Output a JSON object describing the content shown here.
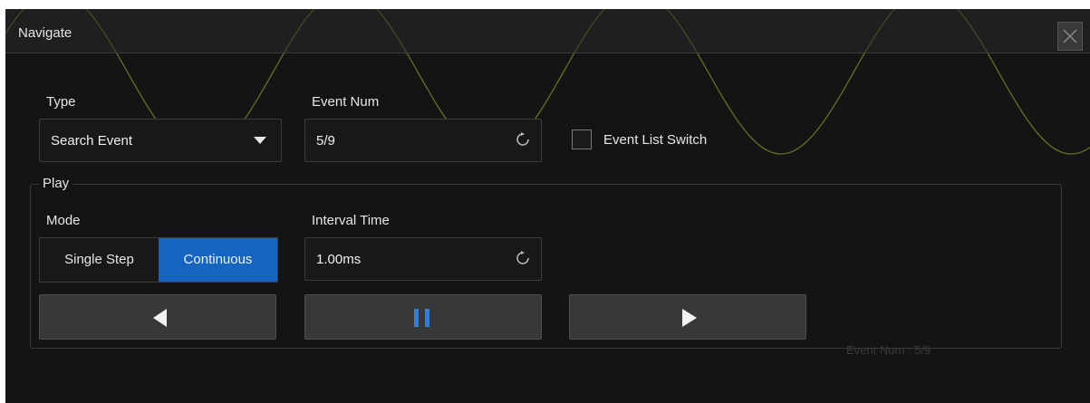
{
  "window": {
    "title": "Navigate"
  },
  "type": {
    "label": "Type",
    "value": "Search Event"
  },
  "event_num": {
    "label": "Event Num",
    "value": "5/9"
  },
  "event_list": {
    "label": "Event List Switch",
    "checked": false
  },
  "play": {
    "legend": "Play",
    "mode_label": "Mode",
    "modes": [
      "Single Step",
      "Continuous"
    ],
    "active_mode": "Continuous",
    "interval_label": "Interval Time",
    "interval_value": "1.00ms"
  },
  "controls": {
    "prev_icon": "triangle-left-icon",
    "pause_icon": "pause-icon",
    "next_icon": "triangle-right-icon"
  },
  "status": {
    "text": "Event Num : 5/9"
  },
  "colors": {
    "accent": "#1565c0",
    "pause": "#2f7fd6",
    "waveform": "#8a8a2a"
  }
}
